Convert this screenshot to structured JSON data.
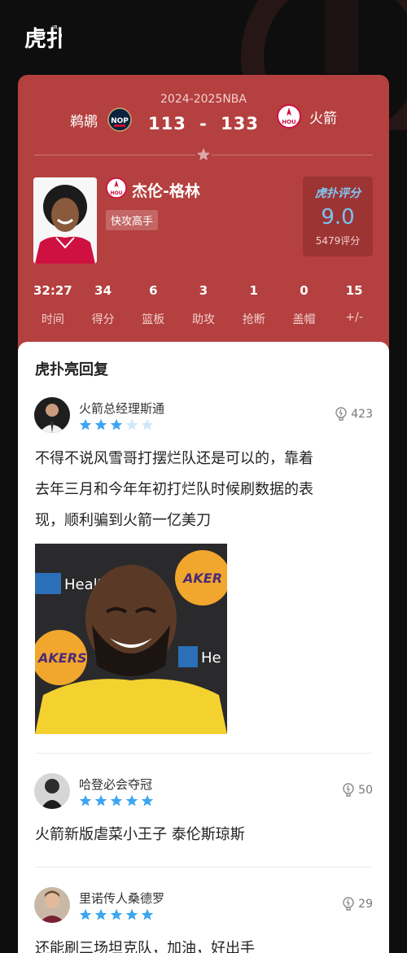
{
  "app": {
    "brand_logo": "hupu-logo"
  },
  "game": {
    "season": "2024-2025NBA",
    "home_team": "鹈鹕",
    "home_logo": "pelicans-logo",
    "away_team": "火箭",
    "away_logo": "rockets-logo",
    "home_score": "113",
    "score_sep": "-",
    "away_score": "133"
  },
  "player": {
    "name": "杰伦-格林",
    "tag": "快攻高手",
    "team_logo": "rockets-logo",
    "rating_title": "虎扑评分",
    "rating_score": "9.0",
    "rating_count": "5479评分"
  },
  "stats": [
    {
      "value": "32:27",
      "label": "时间"
    },
    {
      "value": "34",
      "label": "得分"
    },
    {
      "value": "6",
      "label": "篮板"
    },
    {
      "value": "3",
      "label": "助攻"
    },
    {
      "value": "1",
      "label": "抢断"
    },
    {
      "value": "0",
      "label": "盖帽"
    },
    {
      "value": "15",
      "label": "+/-"
    }
  ],
  "replies": {
    "title": "虎扑亮回复",
    "items": [
      {
        "user": "火箭总经理斯通",
        "stars": 3,
        "likes": "423",
        "text_line1": "不得不说风雪哥打摆烂队还是可以的，靠着",
        "text_line2": "去年三月和今年年初打烂队时候刷数据的表",
        "text_line3": "现，顺利骗到火箭一亿美刀",
        "image_texts": {
          "left": "Healt",
          "right_top": "AKER",
          "left_bottom": "AKERS",
          "right": "He"
        }
      },
      {
        "user": "哈登必会夺冠",
        "stars": 5,
        "likes": "50",
        "text_line1": "火箭新版虐菜小王子 泰伦斯琼斯"
      },
      {
        "user": "里诺传人桑德罗",
        "stars": 5,
        "likes": "29",
        "text_line1": "还能刷三场坦克队，加油，好出手"
      }
    ]
  },
  "colors": {
    "card": "#b4403f",
    "rating_box": "#9d3434",
    "star_on": "#3ca6f0",
    "star_off": "#cfe8fa"
  }
}
